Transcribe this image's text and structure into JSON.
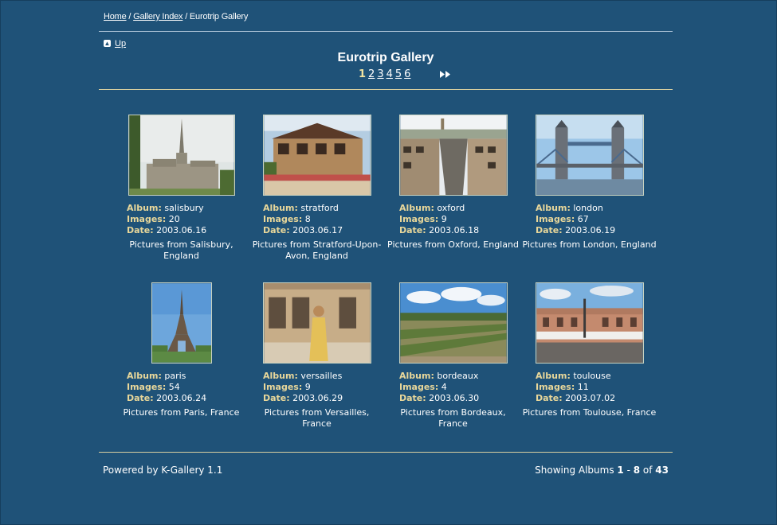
{
  "breadcrumb": {
    "home": "Home",
    "sep1": " / ",
    "index": "Gallery Index",
    "sep2": " / ",
    "current": "Eurotrip Gallery"
  },
  "up": {
    "label": "Up",
    "icon": "up-arrow-icon"
  },
  "gallery": {
    "title": "Eurotrip Gallery",
    "pages": [
      "1",
      "2",
      "3",
      "4",
      "5",
      "6"
    ],
    "current_page": "1",
    "next_icon": "next-page-icon"
  },
  "labels": {
    "album": "Album:",
    "images": "Images:",
    "date": "Date:"
  },
  "albums": [
    {
      "name": "salisbury",
      "images": "20",
      "date": "2003.06.16",
      "description": "Pictures from Salisbury, England"
    },
    {
      "name": "stratford",
      "images": "8",
      "date": "2003.06.17",
      "description": "Pictures from Stratford-Upon-Avon, England"
    },
    {
      "name": "oxford",
      "images": "9",
      "date": "2003.06.18",
      "description": "Pictures from Oxford, England"
    },
    {
      "name": "london",
      "images": "67",
      "date": "2003.06.19",
      "description": "Pictures from London, England"
    },
    {
      "name": "paris",
      "images": "54",
      "date": "2003.06.24",
      "description": "Pictures from Paris, France"
    },
    {
      "name": "versailles",
      "images": "9",
      "date": "2003.06.29",
      "description": "Pictures from Versailles, France"
    },
    {
      "name": "bordeaux",
      "images": "4",
      "date": "2003.06.30",
      "description": "Pictures from Bordeaux, France"
    },
    {
      "name": "toulouse",
      "images": "11",
      "date": "2003.07.02",
      "description": "Pictures from Toulouse, France"
    }
  ],
  "footer": {
    "powered_by": "Powered by K-Gallery 1.1",
    "showing_prefix": "Showing Albums ",
    "range_start": "1",
    "range_sep": " - ",
    "range_end": "8",
    "of": " of ",
    "total": "43"
  },
  "colors": {
    "background": "#1f5278",
    "accent": "#e8d79a",
    "current_page": "#f2e3a0"
  }
}
